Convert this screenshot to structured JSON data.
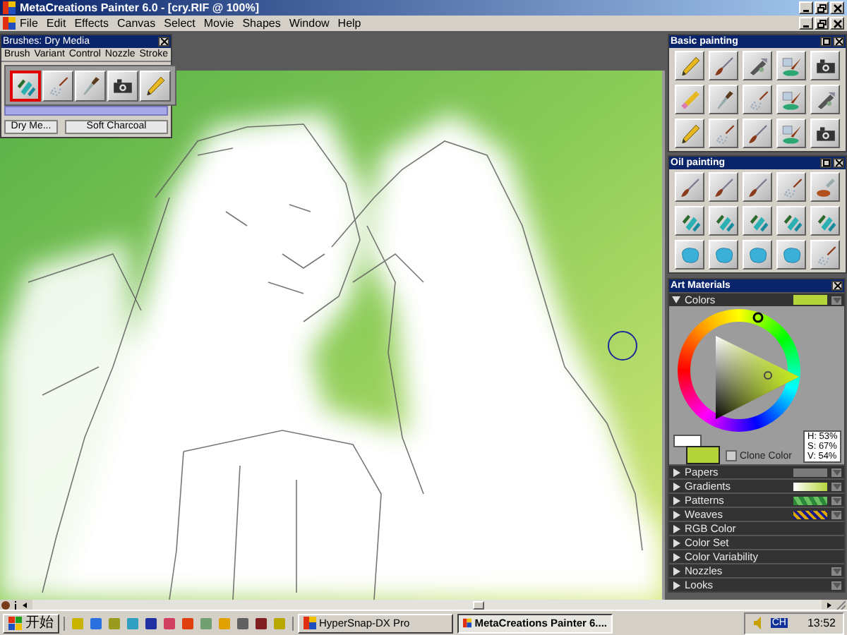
{
  "window": {
    "title": "MetaCreations Painter 6.0 - [cry.RIF @ 100%]"
  },
  "menu_bar": [
    "File",
    "Edit",
    "Effects",
    "Canvas",
    "Select",
    "Movie",
    "Shapes",
    "Window",
    "Help"
  ],
  "brushes_palette": {
    "title": "Brushes: Dry Media",
    "menus": [
      "Brush",
      "Variant",
      "Control",
      "Nozzle",
      "Stroke"
    ],
    "tools": [
      {
        "kind": "chalk",
        "selected": true
      },
      {
        "kind": "spray",
        "selected": false
      },
      {
        "kind": "knife",
        "selected": false
      },
      {
        "kind": "stamp",
        "selected": false
      },
      {
        "kind": "pencil",
        "selected": false
      }
    ],
    "category": "Dry Me...",
    "variant": "Soft Charcoal"
  },
  "palettes": [
    {
      "title": "Basic painting",
      "tools": [
        {
          "kind": "pencil"
        },
        {
          "kind": "brush"
        },
        {
          "kind": "airbrush"
        },
        {
          "kind": "water"
        },
        {
          "kind": "stamp"
        },
        {
          "kind": "eraser"
        },
        {
          "kind": "knife"
        },
        {
          "kind": "spray"
        },
        {
          "kind": "water"
        },
        {
          "kind": "airbrush"
        },
        {
          "kind": "pencil"
        },
        {
          "kind": "spray"
        },
        {
          "kind": "brush"
        },
        {
          "kind": "water"
        },
        {
          "kind": "stamp"
        }
      ]
    },
    {
      "title": "Oil painting",
      "tools": [
        {
          "kind": "brush"
        },
        {
          "kind": "brush"
        },
        {
          "kind": "brush"
        },
        {
          "kind": "spray"
        },
        {
          "kind": "liquid"
        },
        {
          "kind": "chalk"
        },
        {
          "kind": "chalk"
        },
        {
          "kind": "chalk"
        },
        {
          "kind": "chalk"
        },
        {
          "kind": "chalk"
        },
        {
          "kind": "sponge"
        },
        {
          "kind": "sponge"
        },
        {
          "kind": "sponge"
        },
        {
          "kind": "sponge"
        },
        {
          "kind": "spray"
        }
      ]
    }
  ],
  "art_materials": {
    "title": "Art Materials",
    "colors": {
      "label": "Colors",
      "expanded": true,
      "swatches": [
        {
          "kind": "primary",
          "color": "#b5d43c"
        },
        {
          "kind": "secondary",
          "color": "#ffffff"
        }
      ],
      "hsv": [
        "H: 53%",
        "S: 67%",
        "V: 54%"
      ],
      "clone_color": {
        "label": "Clone Color",
        "checked": false
      }
    },
    "sections": [
      {
        "label": "Papers",
        "expanded": false,
        "kind": "paper",
        "menu_button": true
      },
      {
        "label": "Gradients",
        "expanded": false,
        "kind": "gradient",
        "menu_button": true
      },
      {
        "label": "Patterns",
        "expanded": false,
        "kind": "pattern",
        "menu_button": true
      },
      {
        "label": "Weaves",
        "expanded": false,
        "kind": "weave",
        "menu_button": true
      },
      {
        "label": "RGB Color",
        "expanded": false,
        "kind": "plain",
        "menu_button": false
      },
      {
        "label": "Color Set",
        "expanded": false,
        "kind": "plain",
        "menu_button": false
      },
      {
        "label": "Color Variability",
        "expanded": false,
        "kind": "plain",
        "menu_button": false
      },
      {
        "label": "Nozzles",
        "expanded": false,
        "kind": "plain",
        "menu_button": true
      },
      {
        "label": "Looks",
        "expanded": false,
        "kind": "plain",
        "menu_button": true
      }
    ]
  },
  "taskbar": {
    "start": "开始",
    "quick_launch": [
      {
        "color": "#c8b400"
      },
      {
        "color": "#2a6ee0"
      },
      {
        "color": "#9a9a20"
      },
      {
        "color": "#30a0c0"
      },
      {
        "color": "#2030a0"
      },
      {
        "color": "#d04060"
      },
      {
        "color": "#e04010"
      },
      {
        "color": "#70a070"
      },
      {
        "color": "#e0a000"
      },
      {
        "color": "#606060"
      },
      {
        "color": "#802020"
      },
      {
        "color": "#b8a800"
      }
    ],
    "tasks": [
      {
        "label": "HyperSnap-DX Pro",
        "selected": false
      },
      {
        "label": "MetaCreations Painter 6....",
        "selected": true
      }
    ],
    "language": "CH",
    "time": "13:52"
  }
}
